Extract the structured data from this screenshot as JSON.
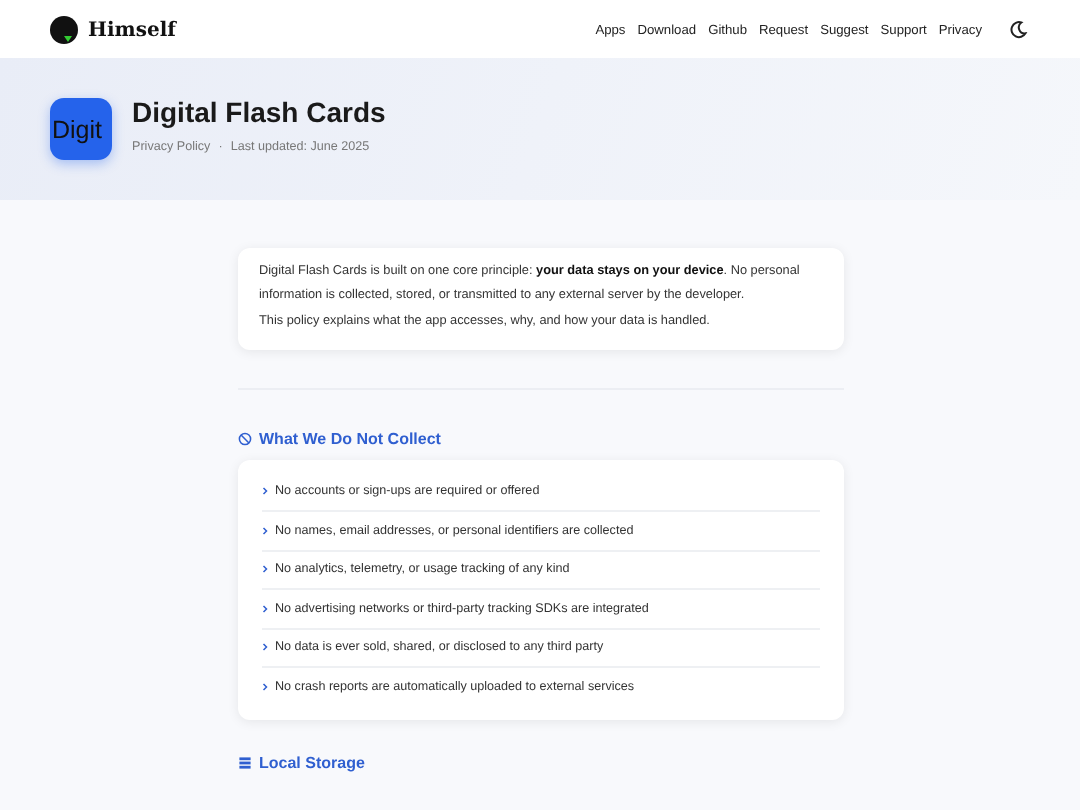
{
  "brand": {
    "name": "Himself"
  },
  "nav": [
    "Apps",
    "Download",
    "Github",
    "Request",
    "Suggest",
    "Support",
    "Privacy"
  ],
  "hero": {
    "icon_text": "Digit",
    "title": "Digital Flash Cards",
    "subtitle": "Privacy Policy",
    "separator": "·",
    "updated": "Last updated: June 2025"
  },
  "intro": [
    "Digital Flash Cards is built on one core principle: **your data stays on your device**. No personal information is collected, stored, or transmitted to any external server by the developer.",
    "This policy explains what the app accesses, why, and how your data is handled."
  ],
  "sections": [
    {
      "kind": "blocked",
      "title": "What We Do Not Collect",
      "items": [
        "No accounts or sign-ups are required or offered",
        "No names, email addresses, or personal identifiers are collected",
        "No analytics, telemetry, or usage tracking of any kind",
        "No advertising networks or third-party tracking SDKs are integrated",
        "No data is ever sold, shared, or disclosed to any third party",
        "No crash reports are automatically uploaded to external services"
      ]
    },
    {
      "kind": "storage",
      "title": "Local Storage"
    }
  ]
}
